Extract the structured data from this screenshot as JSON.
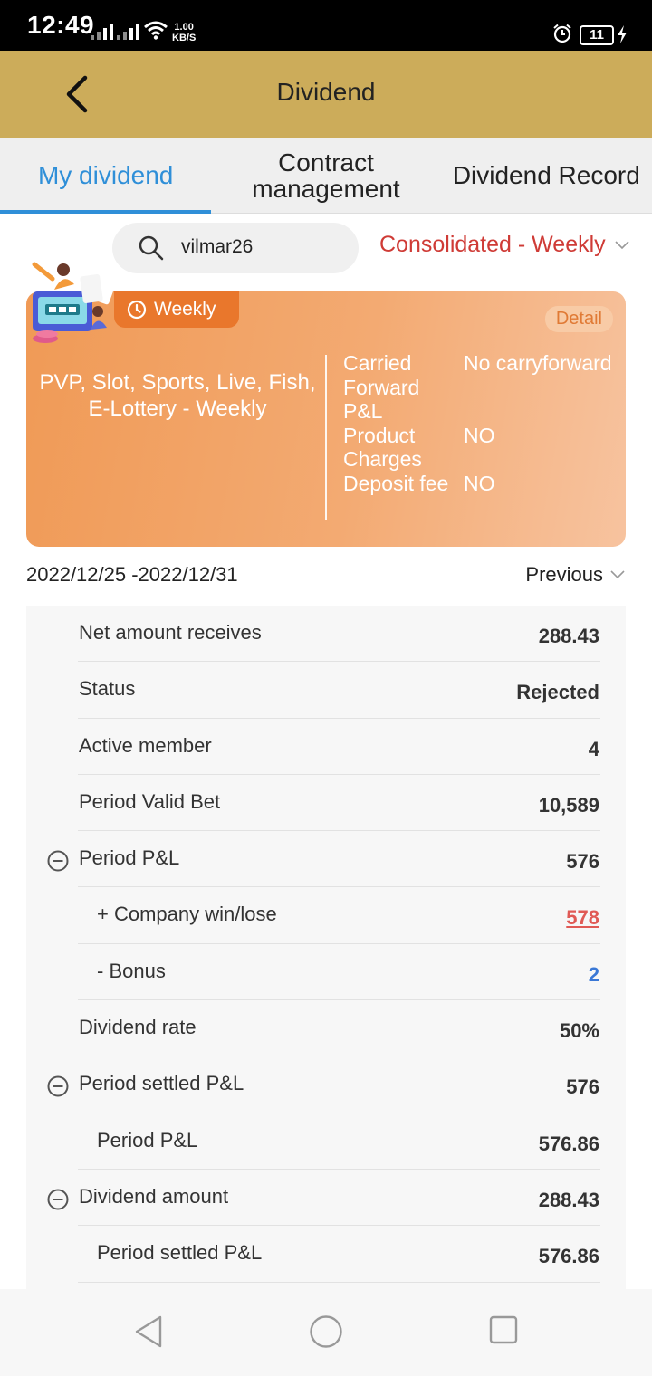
{
  "status_bar": {
    "time": "12:49",
    "net_speed_value": "1.00",
    "net_speed_unit": "KB/S",
    "battery": "11"
  },
  "header": {
    "title": "Dividend"
  },
  "tabs": [
    {
      "label": "My dividend",
      "active": true
    },
    {
      "label": "Contract management",
      "active": false
    },
    {
      "label": "Dividend Record",
      "active": false
    }
  ],
  "search": {
    "value": "vilmar26"
  },
  "filter": {
    "label": "Consolidated - Weekly"
  },
  "banner": {
    "badge": "Weekly",
    "detail": "Detail",
    "description": "PVP, Slot, Sports, Live, Fish, E-Lottery - Weekly",
    "attributes": [
      {
        "key": "Carried Forward P&L",
        "value": "No carryforward"
      },
      {
        "key": "Product Charges",
        "value": "NO"
      },
      {
        "key": "Deposit fee",
        "value": "NO"
      }
    ]
  },
  "period": {
    "range": "2022/12/25 -2022/12/31",
    "previous_label": "Previous"
  },
  "rows": [
    {
      "label": "Net amount receives",
      "value": "288.43"
    },
    {
      "label": "Status",
      "value": "Rejected"
    },
    {
      "label": "Active member",
      "value": "4"
    },
    {
      "label": "Period Valid Bet",
      "value": "10,589"
    },
    {
      "label": "Period P&L",
      "value": "576"
    },
    {
      "label": "+ Company win/lose",
      "value": "578"
    },
    {
      "label": "- Bonus",
      "value": "2"
    },
    {
      "label": "Dividend rate",
      "value": "50%"
    },
    {
      "label": "Period settled P&L",
      "value": "576"
    },
    {
      "label": "Period P&L",
      "value": "576.86"
    },
    {
      "label": "Dividend amount",
      "value": "288.43"
    },
    {
      "label": "Period settled P&L",
      "value": "576.86"
    }
  ],
  "colors": {
    "header_bg": "#ccac5a",
    "accent_blue": "#2f8fd8",
    "filter_red": "#cf3b36",
    "banner_orange": "#f09a56"
  }
}
